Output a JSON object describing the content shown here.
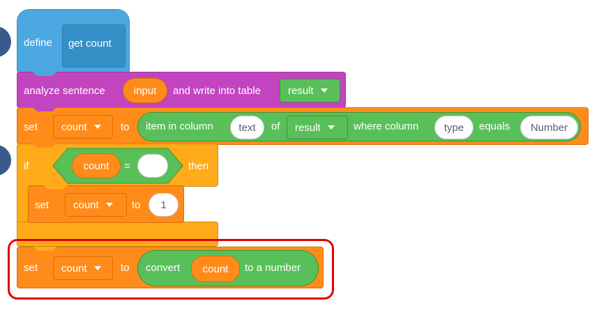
{
  "define_block": {
    "label": "define",
    "name": "get count"
  },
  "analyze_block": {
    "label": "analyze sentence",
    "input_label": "input",
    "write_label": "and write into table",
    "table_value": "result"
  },
  "set_block_1": {
    "label": "set",
    "variable": "count",
    "to_label": "to",
    "reporter": {
      "prefix": "item in column",
      "column_value": "text",
      "of_label": "of",
      "table_value": "result",
      "where_label": "where column",
      "where_column_value": "type",
      "equals_label": "equals",
      "equals_value": "Number"
    }
  },
  "if_block": {
    "if_label": "if",
    "variable": "count",
    "equals_sign": "=",
    "compare_value": "",
    "then_label": "then"
  },
  "set_block_2": {
    "label": "set",
    "variable": "count",
    "to_label": "to",
    "value": "1"
  },
  "set_block_3": {
    "label": "set",
    "variable": "count",
    "to_label": "to",
    "reporter": {
      "prefix": "convert",
      "variable": "count",
      "suffix": "to a number"
    }
  },
  "colors": {
    "define": "#4CA8E0",
    "procedure": "#C344BF",
    "variables": "#FF8C1A",
    "control": "#FFAB19",
    "operators": "#59C059",
    "highlight": "#E60000"
  }
}
